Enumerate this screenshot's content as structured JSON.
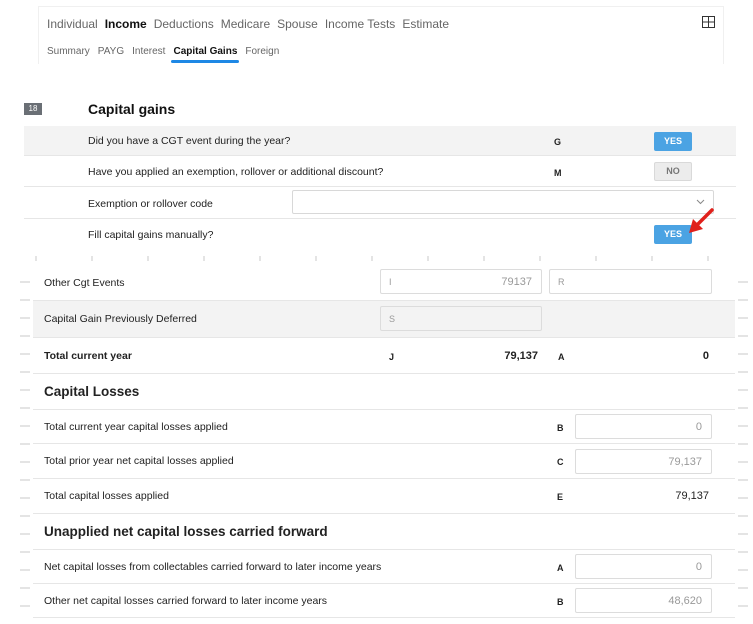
{
  "nav": {
    "main_tabs": [
      "Individual",
      "Income",
      "Deductions",
      "Medicare",
      "Spouse",
      "Income Tests",
      "Estimate"
    ],
    "active_main": "Income",
    "sub_tabs": [
      "Summary",
      "PAYG",
      "Interest",
      "Capital Gains",
      "Foreign"
    ],
    "active_sub": "Capital Gains",
    "layout_icon": "grid-icon"
  },
  "section": {
    "number": "18",
    "title": "Capital gains",
    "questions": [
      {
        "label": "Did you have a CGT event during the year?",
        "code": "G",
        "answer": "YES"
      },
      {
        "label": "Have you applied an exemption, rollover or additional discount?",
        "code": "M",
        "answer": "NO"
      },
      {
        "label": "Exemption or rollover code",
        "select_value": ""
      },
      {
        "label": "Fill capital gains manually?",
        "answer": "YES"
      }
    ]
  },
  "rows": {
    "other_cgt": {
      "label": "Other Cgt Events",
      "field1_code": "I",
      "field1_value": "79137",
      "field2_code": "R",
      "field2_value": ""
    },
    "previously_deferred": {
      "label": "Capital Gain Previously Deferred",
      "field_code": "S",
      "field_value": ""
    },
    "total_current": {
      "label": "Total current year",
      "code_j": "J",
      "value_j": "79,137",
      "code_a": "A",
      "value_a": "0"
    }
  },
  "capital_losses": {
    "heading": "Capital Losses",
    "items": [
      {
        "label": "Total current year capital losses applied",
        "code": "B",
        "value": "0"
      },
      {
        "label": "Total prior year net capital losses applied",
        "code": "C",
        "value": "79,137"
      },
      {
        "label": "Total capital losses applied",
        "code": "E",
        "value": "79,137"
      }
    ]
  },
  "carried_forward": {
    "heading": "Unapplied net capital losses carried forward",
    "items": [
      {
        "label": "Net capital losses from collectables carried forward to later income years",
        "code": "A",
        "value": "0"
      },
      {
        "label": "Other net capital losses carried forward to later income years",
        "code": "B",
        "value": "48,620"
      }
    ]
  },
  "colors": {
    "accent": "#1e88e5",
    "yes_button": "#4ba3e3",
    "arrow": "#e0201b"
  }
}
